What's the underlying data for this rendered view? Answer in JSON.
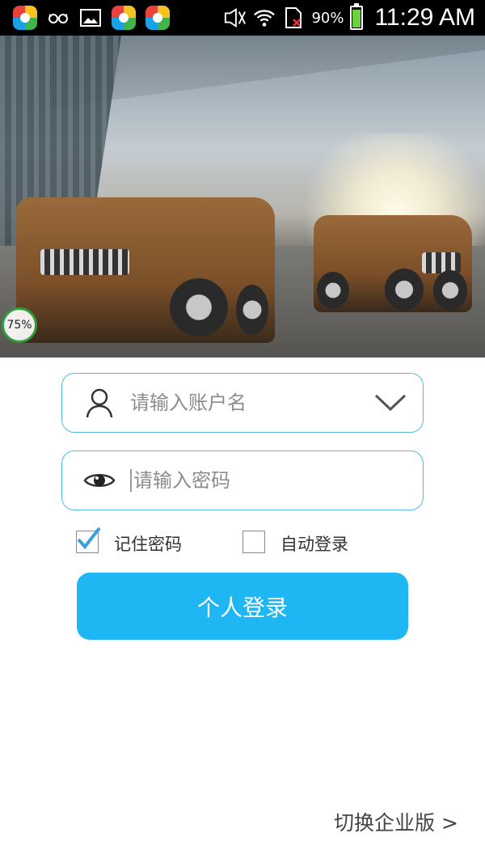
{
  "status_bar": {
    "battery_percent": "90%",
    "time": "11:29 AM",
    "icons": [
      "app-icon",
      "glasses-icon",
      "image-icon",
      "app-icon",
      "app-icon",
      "mute-icon",
      "wifi-icon",
      "sim-error-icon",
      "battery-icon"
    ]
  },
  "hero": {
    "progress_badge": "75%"
  },
  "login_form": {
    "account_placeholder": "请输入账户名",
    "password_placeholder": "请输入密码",
    "remember_label": "记住密码",
    "remember_checked": true,
    "auto_login_label": "自动登录",
    "auto_login_checked": false,
    "submit_label": "个人登录"
  },
  "footer": {
    "switch_label": "切换企业版 >"
  },
  "colors": {
    "accent": "#1fb7f3",
    "field_border": "#4fb8e8",
    "check_blue": "#3aa0e0"
  }
}
